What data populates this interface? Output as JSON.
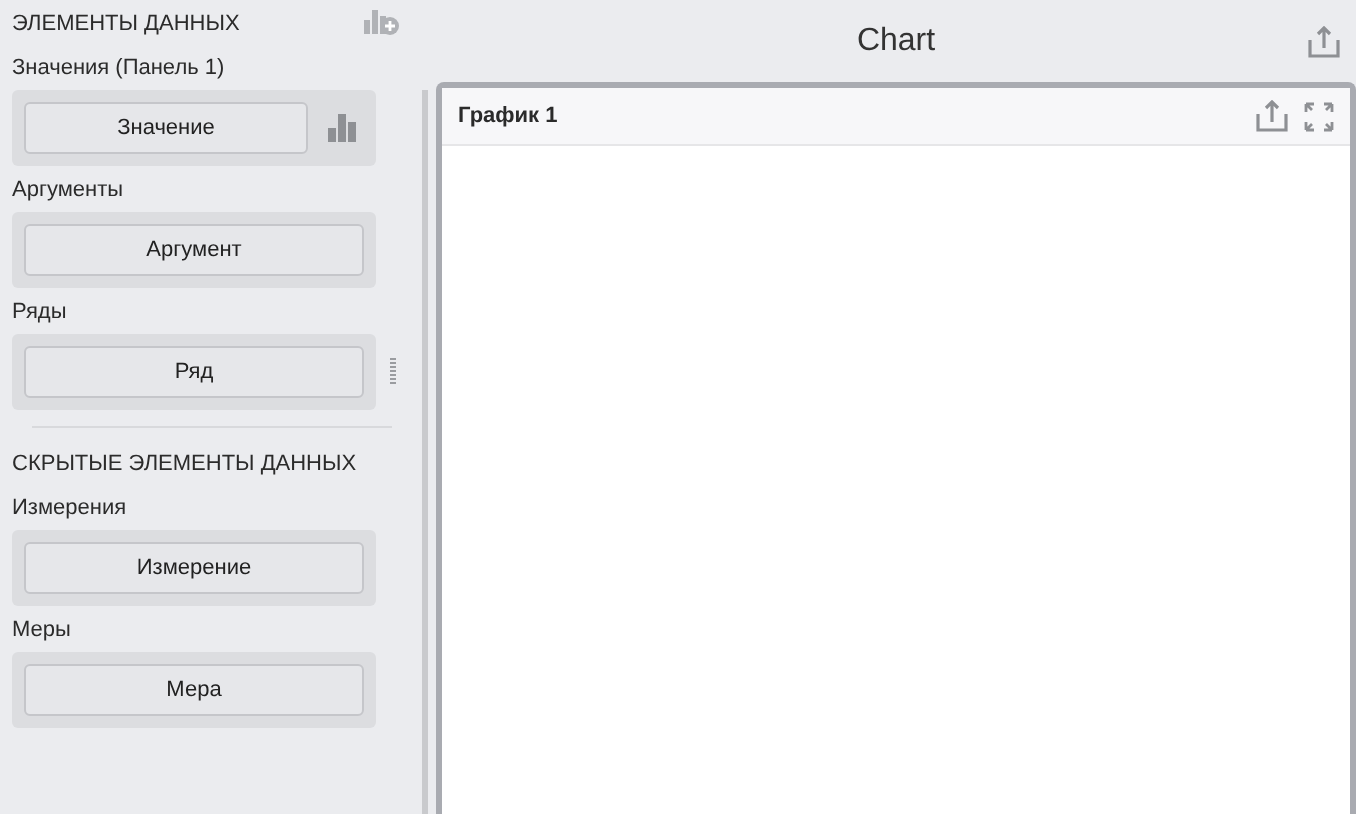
{
  "data_panel": {
    "groups": [
      {
        "kind": "header",
        "text": "ЭЛЕМЕНТЫ ДАННЫХ",
        "divider": false,
        "add_icon": true
      },
      {
        "kind": "field",
        "label": "Значения (Панель 1)",
        "button": "Значение",
        "chart_icon": true,
        "drag_handle": false
      },
      {
        "kind": "field",
        "label": "Аргументы",
        "button": "Аргумент",
        "chart_icon": false,
        "drag_handle": false
      },
      {
        "kind": "field",
        "label": "Ряды",
        "button": "Ряд",
        "chart_icon": false,
        "drag_handle": true
      },
      {
        "kind": "header",
        "text": "СКРЫТЫЕ ЭЛЕМЕНТЫ ДАННЫХ",
        "divider": true,
        "add_icon": false
      },
      {
        "kind": "field",
        "label": "Измерения",
        "button": "Измерение",
        "chart_icon": false,
        "drag_handle": false
      },
      {
        "kind": "field",
        "label": "Меры",
        "button": "Мера",
        "chart_icon": false,
        "drag_handle": false
      }
    ]
  },
  "dashboard": {
    "title": "Chart",
    "item": {
      "caption": "График 1"
    }
  }
}
